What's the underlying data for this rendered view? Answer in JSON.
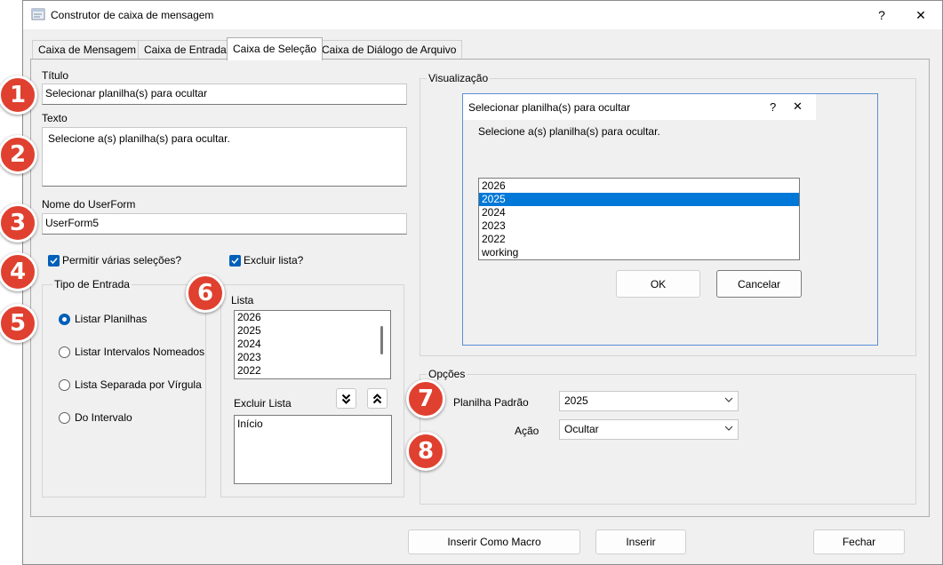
{
  "window": {
    "title": "Construtor de caixa de mensagem",
    "help": "?",
    "close": "✕"
  },
  "tabs": [
    {
      "label": "Caixa de Mensagem"
    },
    {
      "label": "Caixa de Entrada"
    },
    {
      "label": "Caixa de Seleção"
    },
    {
      "label": "Caixa de Diálogo de Arquivo"
    }
  ],
  "form": {
    "titulo_label": "Título",
    "titulo_value": "Selecionar planilha(s) para ocultar",
    "texto_label": "Texto",
    "texto_value": "Selecione a(s) planilha(s) para ocultar.",
    "userform_label": "Nome do UserForm",
    "userform_value": "UserForm5",
    "permitir_label": "Permitir várias seleções?",
    "permitir_checked": true,
    "excluir_lista_label": "Excluir lista?",
    "excluir_lista_checked": true
  },
  "tipo_entrada": {
    "title": "Tipo de Entrada",
    "options": [
      {
        "label": "Listar Planilhas",
        "selected": true
      },
      {
        "label": "Listar Intervalos Nomeados",
        "selected": false
      },
      {
        "label": "Lista Separada por Vírgula",
        "selected": false
      },
      {
        "label": "Do Intervalo",
        "selected": false
      }
    ]
  },
  "lista": {
    "label": "Lista",
    "items": [
      "2026",
      "2025",
      "2024",
      "2023",
      "2022"
    ],
    "excluir_label": "Excluir Lista",
    "excluir_items": [
      "Início"
    ],
    "move_down_icon": "double-chevron-down-icon",
    "move_up_icon": "double-chevron-up-icon"
  },
  "visualizacao": {
    "title": "Visualização",
    "dialog_title": "Selecionar planilha(s) para ocultar",
    "dialog_help": "?",
    "dialog_close": "✕",
    "dialog_text": "Selecione a(s) planilha(s) para ocultar.",
    "items": [
      "2026",
      "2025",
      "2024",
      "2023",
      "2022",
      "working"
    ],
    "selected_index": 1,
    "ok_label": "OK",
    "cancel_label": "Cancelar"
  },
  "opcoes": {
    "title": "Opções",
    "planilha_label": "Planilha Padrão",
    "planilha_value": "2025",
    "acao_label": "Ação",
    "acao_value": "Ocultar"
  },
  "footer": {
    "inserir_macro": "Inserir Como Macro",
    "inserir": "Inserir",
    "fechar": "Fechar"
  },
  "badges": [
    "1",
    "2",
    "3",
    "4",
    "5",
    "6",
    "7",
    "8"
  ],
  "colors": {
    "badge": "#e0402f",
    "accent": "#005fb8",
    "selection": "#0078d7"
  }
}
